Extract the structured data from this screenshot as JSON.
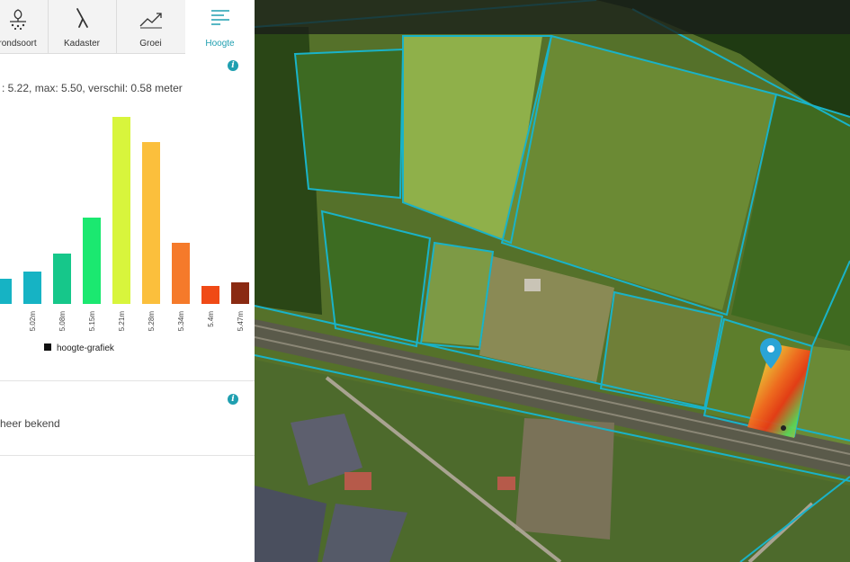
{
  "tabs": [
    {
      "label": "rondsoort",
      "icon": "soil-type-icon"
    },
    {
      "label": "Kadaster",
      "icon": "cadastre-icon"
    },
    {
      "label": "Groei",
      "icon": "growth-chart-icon"
    },
    {
      "label": "Hoogte",
      "icon": "height-list-icon",
      "active": true
    }
  ],
  "height": {
    "stats": ": 5.22, max: 5.50, verschil: 0.58 meter"
  },
  "soil": {
    "text": "heer bekend"
  },
  "chart_data": {
    "type": "bar",
    "categories": [
      "",
      "5.02m",
      "5.08m",
      "5.15m",
      "5.21m",
      "5.28m",
      "5.34m",
      "5.4m",
      "5.47m"
    ],
    "values": [
      14,
      18,
      28,
      48,
      104,
      90,
      34,
      10,
      12
    ],
    "colors": [
      "#16b3c4",
      "#16b3c4",
      "#16c78a",
      "#1be870",
      "#d8f53c",
      "#fbbf3c",
      "#f57a2a",
      "#f04a16",
      "#8a2a12"
    ],
    "ylim": [
      0,
      110
    ],
    "legend": "hoogte-grafiek",
    "legend_color": "#111111",
    "grid": false
  },
  "map": {
    "boundary_color": "#19b3c8",
    "marker_color": "#2aa4d6"
  }
}
